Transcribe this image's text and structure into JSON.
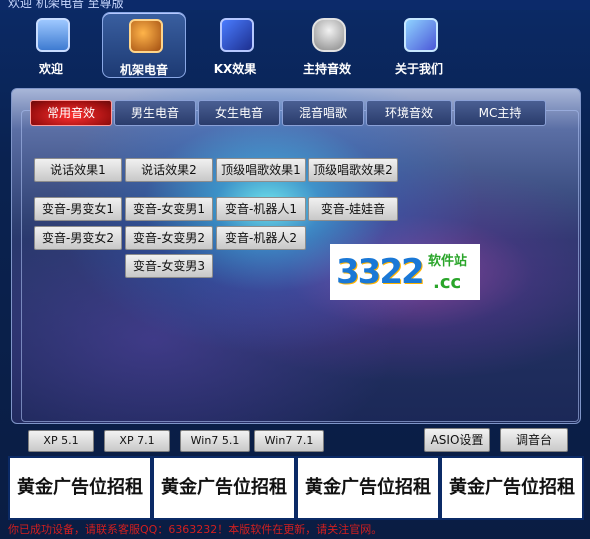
{
  "window": {
    "title": "欢迎 机架电音 至尊版"
  },
  "topnav": {
    "items": [
      {
        "label": "欢迎",
        "icon": "monitor-icon"
      },
      {
        "label": "机架电音",
        "icon": "guitar-icon"
      },
      {
        "label": "KX效果",
        "icon": "kx-logo-icon"
      },
      {
        "label": "主持音效",
        "icon": "microphone-icon"
      },
      {
        "label": "关于我们",
        "icon": "about-icon"
      }
    ]
  },
  "tabs": [
    "常用音效",
    "男生电音",
    "女生电音",
    "混音唱歌",
    "环境音效",
    "MC主持"
  ],
  "effects": {
    "row1": [
      "说话效果1",
      "说话效果2",
      "顶级唱歌效果1",
      "顶级唱歌效果2"
    ],
    "row2": [
      "变音-男变女1",
      "变音-女变男1",
      "变音-机器人1",
      "变音-娃娃音"
    ],
    "row3": [
      "变音-男变女2",
      "变音-女变男2",
      "变音-机器人2"
    ],
    "row4": [
      "变音-女变男3"
    ]
  },
  "watermark": {
    "main": "3322",
    "sub": "软件站",
    "domain": ".cc"
  },
  "bottom_buttons": {
    "presets": [
      "XP 5.1",
      "XP 7.1",
      "Win7 5.1",
      "Win7 7.1"
    ],
    "asio": "ASIO设置",
    "mixer": "调音台"
  },
  "ads": [
    "黄金广告位招租",
    "黄金广告位招租",
    "黄金广告位招租",
    "黄金广告位招租"
  ],
  "status": {
    "text": "你已成功设备，请联系客服QQ：6363232！本版软件在更新，请关注官网。"
  },
  "colors": {
    "accent": "#ff3030",
    "status_text": "#d21f1f"
  }
}
